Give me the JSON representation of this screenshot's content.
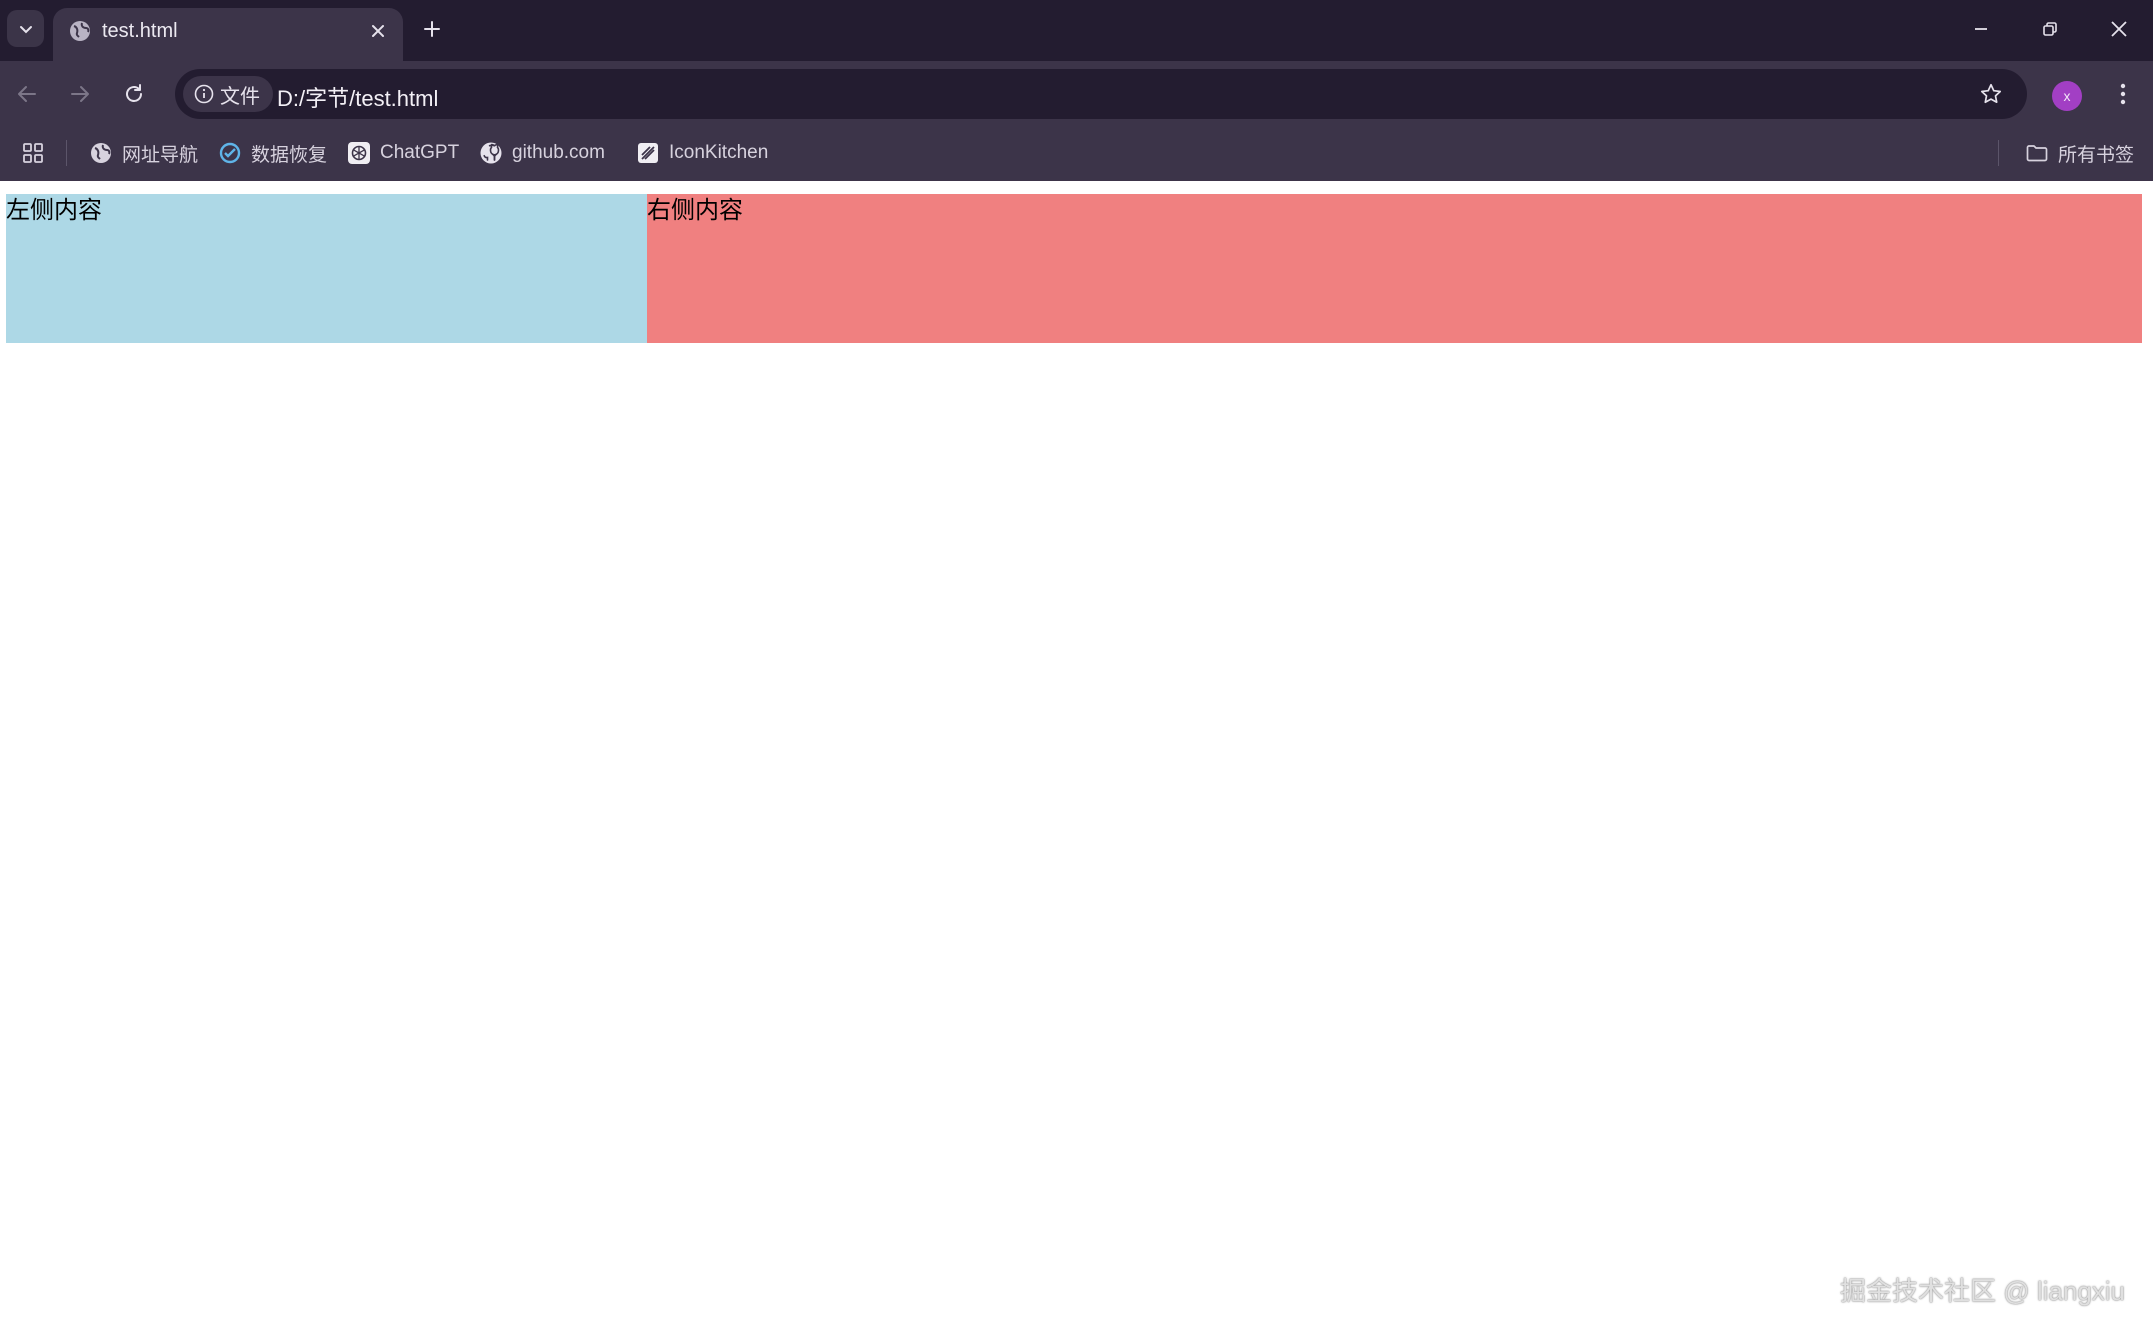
{
  "browser": {
    "tab": {
      "title": "test.html"
    },
    "omnibox": {
      "site_chip_label": "文件",
      "url": "D:/字节/test.html"
    },
    "profile": {
      "initial": "x"
    },
    "bookmarks": [
      {
        "label": "网址导航",
        "icon": "globe-icon"
      },
      {
        "label": "数据恢复",
        "icon": "recovery-icon"
      },
      {
        "label": "ChatGPT",
        "icon": "chatgpt-icon"
      },
      {
        "label": "github.com",
        "icon": "github-icon"
      },
      {
        "label": "IconKitchen",
        "icon": "iconkitchen-icon"
      }
    ],
    "all_bookmarks_label": "所有书签"
  },
  "page": {
    "left_panel": {
      "text": "左侧内容",
      "color": "#add8e6"
    },
    "right_panel": {
      "text": "右侧内容",
      "color": "#f08080"
    }
  },
  "watermark": "掘金技术社区 @ liangxiu",
  "colors": {
    "titlebar": "#231c30",
    "toolbar": "#3c3449",
    "omnibox": "#231c30",
    "avatar": "#a23fc4"
  }
}
